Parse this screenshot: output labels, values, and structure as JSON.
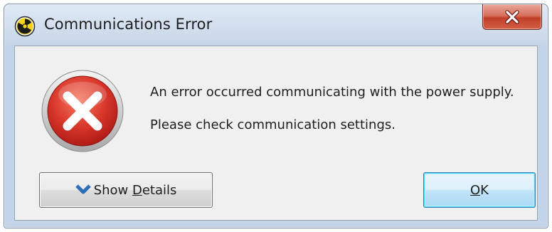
{
  "window": {
    "title": "Communications Error",
    "close_label": "x",
    "app_icon": "radiation-icon"
  },
  "dialog": {
    "icon": "error-x-icon",
    "message_line1": "An error occurred communicating with the power supply.",
    "message_line2": "Please check communication settings."
  },
  "buttons": {
    "details": {
      "pre": "Show ",
      "accel": "D",
      "post": "etails",
      "icon": "chevron-down-icon"
    },
    "ok": {
      "accel": "O",
      "post": "K"
    }
  },
  "colors": {
    "error_red": "#d8362a",
    "close_red": "#c2402b",
    "chevron_blue": "#2f6fb6",
    "dialog_bg": "#f0f0f0"
  }
}
